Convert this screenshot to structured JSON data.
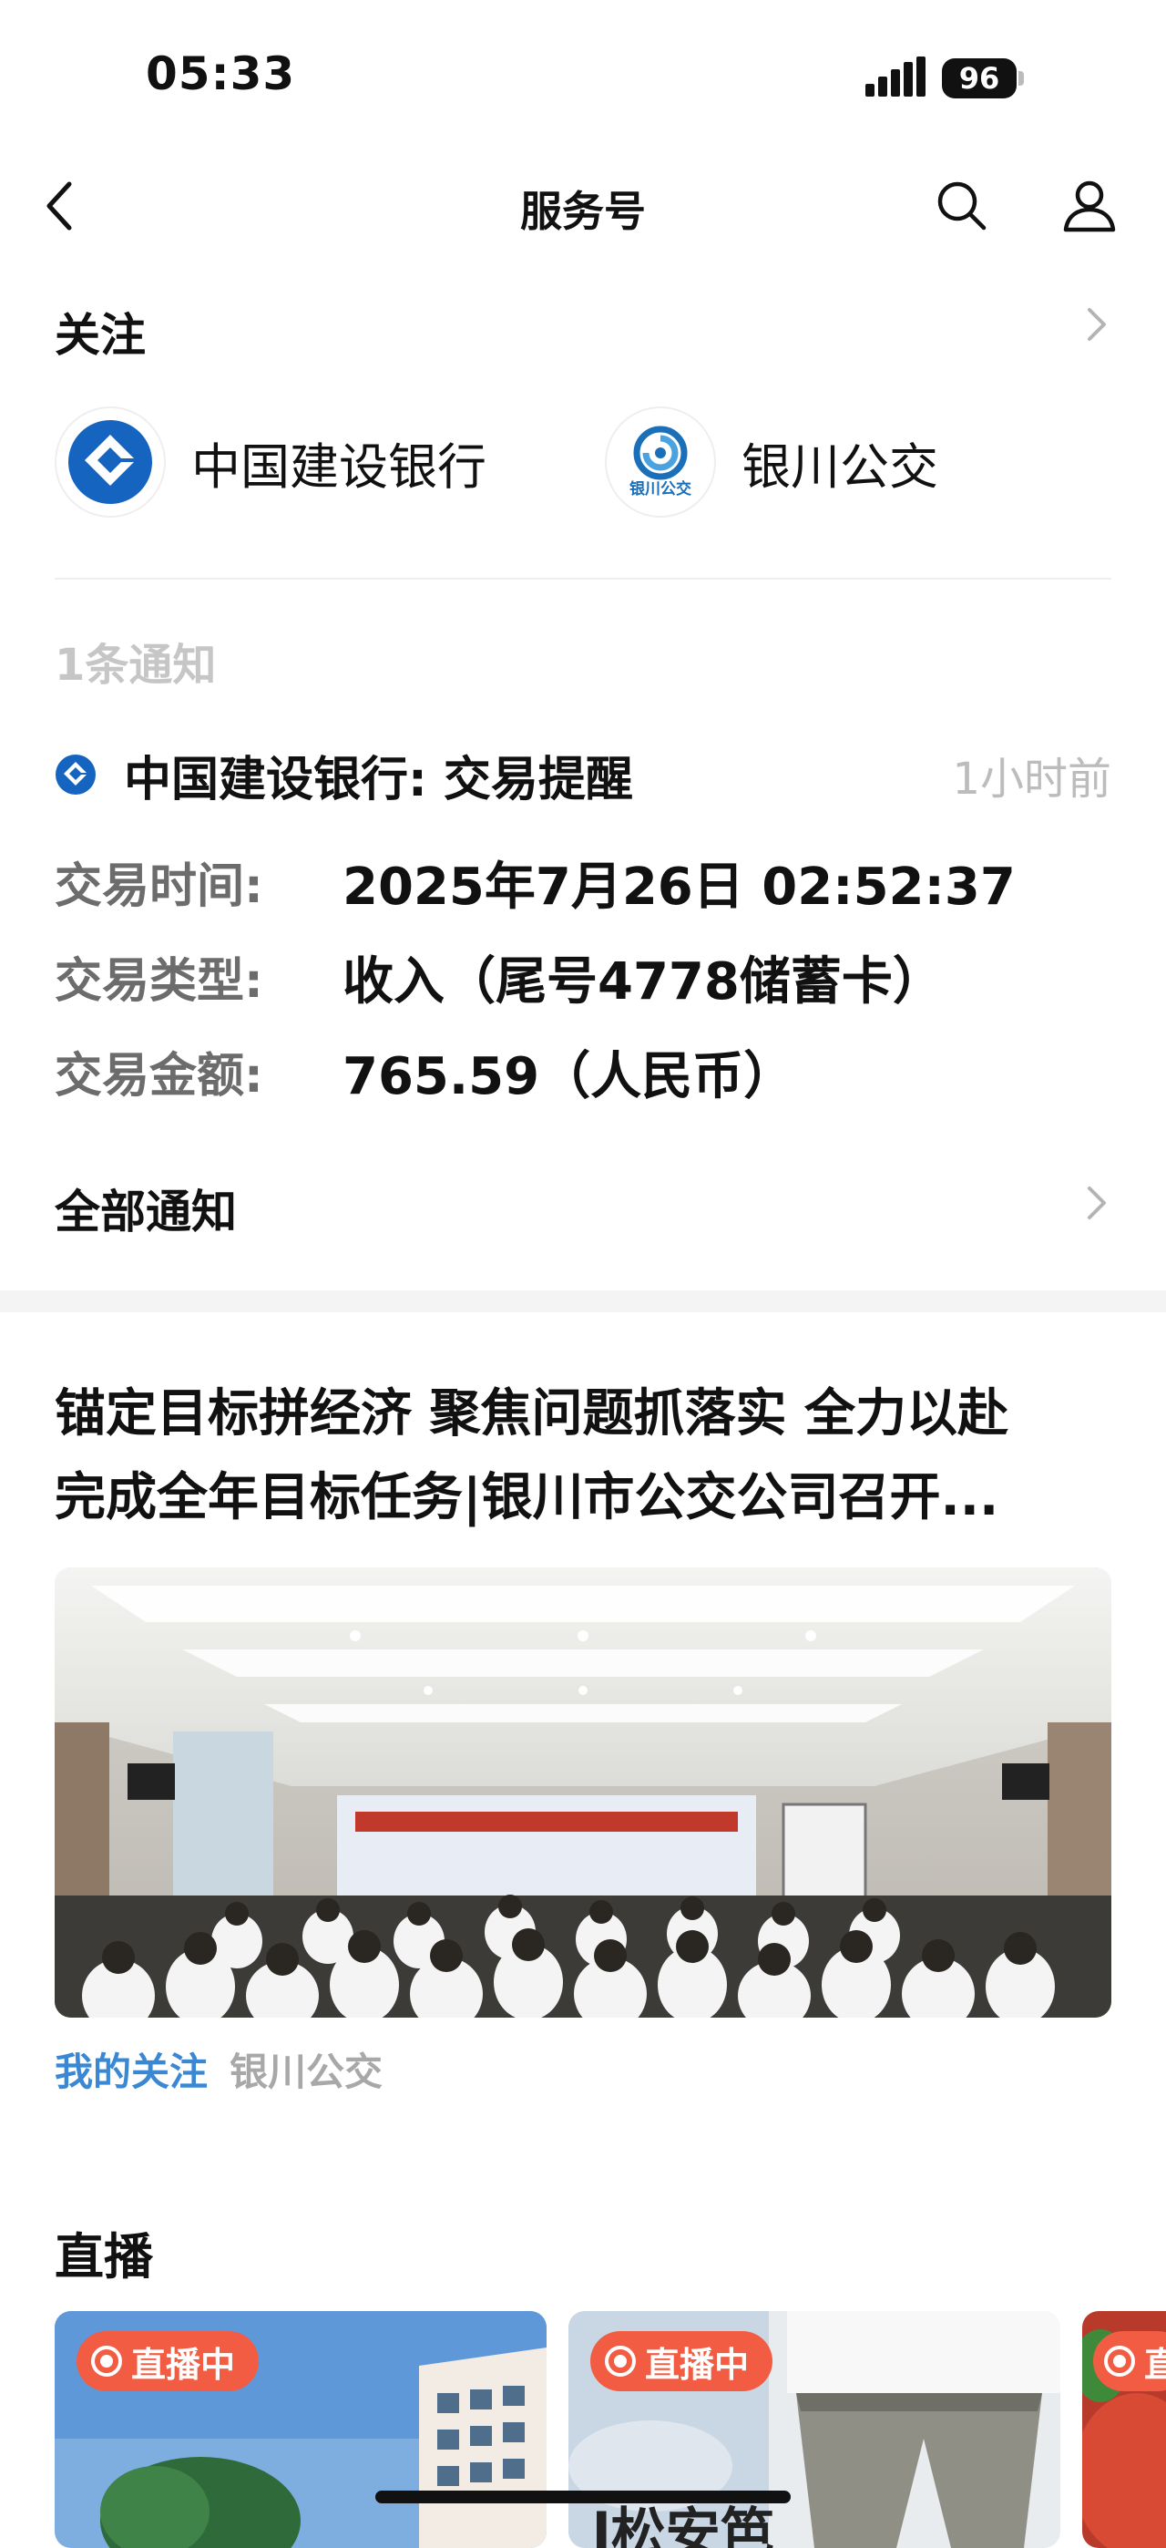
{
  "status_bar": {
    "time": "05:33",
    "battery": "96"
  },
  "nav": {
    "title": "服务号"
  },
  "follow_section": {
    "heading": "关注",
    "accounts": [
      {
        "name": "中国建设银行",
        "logo": "ccb-logo",
        "color": "#1565c0"
      },
      {
        "name": "银川公交",
        "logo": "yinchuan-bus-logo",
        "logo_text": "银川公交",
        "color": "#1a6fb8"
      }
    ]
  },
  "notifications": {
    "count_label": "1条通知",
    "item": {
      "title": "中国建设银行: 交易提醒",
      "time": "1小时前",
      "rows": [
        {
          "label": "交易时间:",
          "value": "2025年7月26日 02:52:37"
        },
        {
          "label": "交易类型:",
          "value": "收入（尾号4778储蓄卡）"
        },
        {
          "label": "交易金额:",
          "value": "765.59（人民币）"
        }
      ]
    },
    "all_label": "全部通知"
  },
  "article": {
    "title_line1": "锚定目标拼经济 聚焦问题抓落实 全力以赴",
    "title_line2": "完成全年目标任务|银川市公交公司召开...",
    "tag_follow": "我的关注",
    "tag_source": "银川公交"
  },
  "live": {
    "heading": "直播",
    "badge": "直播中",
    "cards": [
      {
        "badge": "直播中"
      },
      {
        "badge": "直播中",
        "caption": "l松安笆"
      },
      {
        "badge": "直"
      }
    ]
  },
  "colors": {
    "accent_blue": "#3a87d4",
    "live_red": "#f25c43",
    "ccb_blue": "#1565c0"
  }
}
